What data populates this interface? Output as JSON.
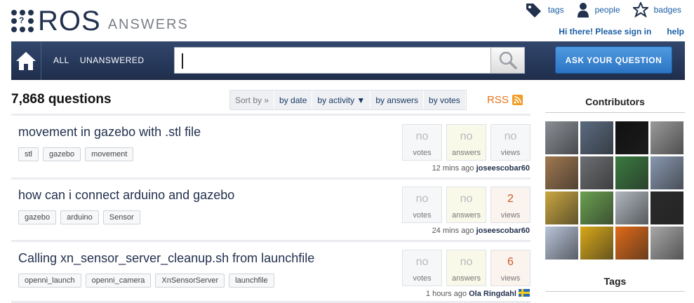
{
  "logo": {
    "brand": "ROS",
    "product": "ANSWERS",
    "dot_glyph": "?"
  },
  "topnav": [
    {
      "label": "tags",
      "icon": "tag-icon"
    },
    {
      "label": "people",
      "icon": "person-icon"
    },
    {
      "label": "badges",
      "icon": "badge-star-icon"
    }
  ],
  "signin": {
    "greeting": "Hi there! Please sign in",
    "help": "help"
  },
  "navbar": {
    "home_icon": "home-icon",
    "links": [
      "ALL",
      "UNANSWERED"
    ],
    "search_value": "",
    "search_icon": "magnifier-icon",
    "ask_label": "ASK YOUR QUESTION"
  },
  "main": {
    "question_count": "7,868 questions",
    "sort": {
      "prefix": "Sort by »",
      "options": [
        "by date",
        "by activity ▼",
        "by answers",
        "by votes"
      ]
    },
    "rss_label": "RSS"
  },
  "questions": [
    {
      "title": "movement in gazebo with .stl file",
      "tags": [
        "stl",
        "gazebo",
        "movement"
      ],
      "votes": "no",
      "votes_label": "votes",
      "answers": "no",
      "answers_label": "answers",
      "views": "no",
      "views_label": "views",
      "time": "12 mins ago",
      "user": "joseescobar60"
    },
    {
      "title": "how can i connect arduino and gazebo",
      "tags": [
        "gazebo",
        "arduino",
        "Sensor"
      ],
      "votes": "no",
      "votes_label": "votes",
      "answers": "no",
      "answers_label": "answers",
      "views": "2",
      "views_label": "views",
      "time": "24 mins ago",
      "user": "joseescobar60"
    },
    {
      "title": "Calling xn_sensor_server_cleanup.sh from launchfile",
      "tags": [
        "openni_launch",
        "openni_camera",
        "XnSensorServer",
        "launchfile"
      ],
      "votes": "no",
      "votes_label": "votes",
      "answers": "no",
      "answers_label": "answers",
      "views": "6",
      "views_label": "views",
      "time": "1 hours ago",
      "user": "Ola Ringdahl"
    }
  ],
  "sidebar": {
    "contributors_title": "Contributors",
    "tags_title": "Tags",
    "avatar_colors": [
      "#8a8f96",
      "#5a6b80",
      "#111111",
      "#9a9a9a",
      "#a07850",
      "#6c6f72",
      "#3a7a40",
      "#8898b0",
      "#c9a640",
      "#6aa050",
      "#b0b8c0",
      "#2a2a2a",
      "#b8c4d8",
      "#d8a818",
      "#e06a18",
      "#a8a8a8"
    ]
  },
  "colors": {
    "navy": "#22314e",
    "link": "#1b5fa5",
    "accent_orange": "#e8731c"
  }
}
